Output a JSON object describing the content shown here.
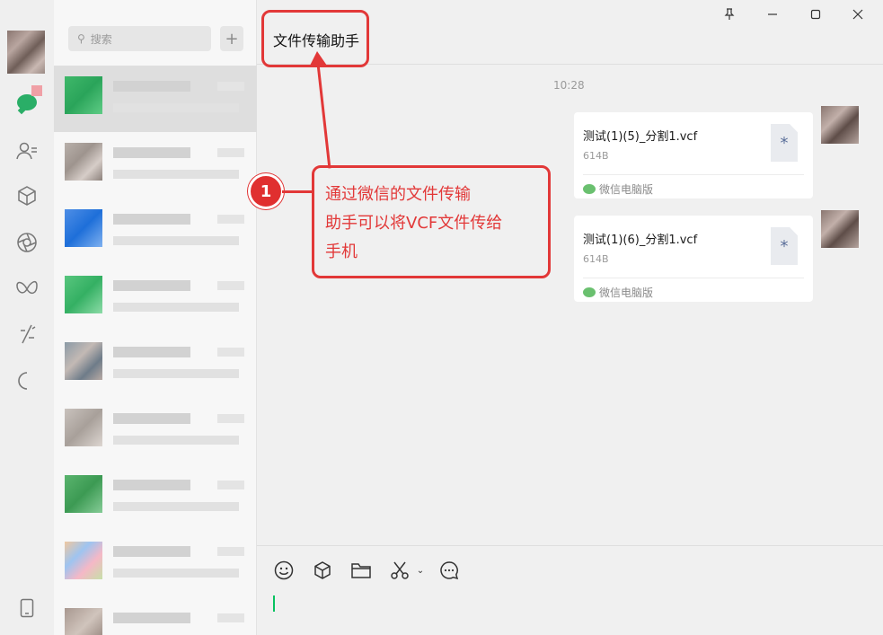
{
  "colors": {
    "accent": "#07c160",
    "annotation": "#e23838",
    "rail_bg": "#efefef",
    "list_bg": "#f7f7f7",
    "chat_bg": "#f0f0f0"
  },
  "rail": {
    "icons": [
      "avatar",
      "chat-icon",
      "contacts-icon",
      "box-icon",
      "aperture-icon",
      "butterfly-icon",
      "sparkle-icon",
      "half-circle-icon",
      "phone-icon"
    ]
  },
  "search": {
    "placeholder": "搜索",
    "add_label": "+"
  },
  "chat": {
    "title": "文件传输助手",
    "timestamp": "10:28",
    "messages": [
      {
        "file_name": "测试(1)(5)_分割1.vcf",
        "size": "614B",
        "source": "微信电脑版"
      },
      {
        "file_name": "测试(1)(6)_分割1.vcf",
        "size": "614B",
        "source": "微信电脑版"
      }
    ]
  },
  "annotation": {
    "step_number": "1",
    "text": "通过微信的文件传输\n助手可以将VCF文件传给\n手机"
  }
}
